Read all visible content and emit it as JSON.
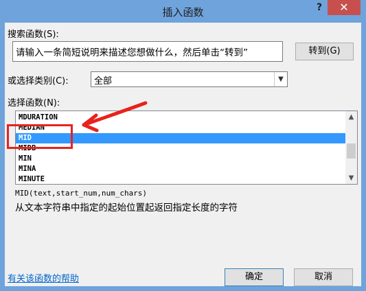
{
  "window": {
    "title": "插入函数",
    "help_label": "?",
    "close_label": "✕"
  },
  "search": {
    "label": "搜索函数(S):",
    "value": "请输入一条简短说明来描述您想做什么，然后单击“转到”",
    "goto_label": "转到(G)"
  },
  "category": {
    "label": "或选择类别(C):",
    "value": "全部"
  },
  "function_list": {
    "label": "选择函数(N):",
    "items": [
      "MDURATION",
      "MEDIAN",
      "MID",
      "MIDB",
      "MIN",
      "MINA",
      "MINUTE"
    ],
    "selected_index": 2
  },
  "syntax": "MID(text,start_num,num_chars)",
  "description": "从文本字符串中指定的起始位置起返回指定长度的字符",
  "footer": {
    "help_link": "有关该函数的帮助",
    "ok_label": "确定",
    "cancel_label": "取消"
  },
  "colors": {
    "title_bar": "#6fa3dc",
    "close_button": "#c7504f",
    "selection": "#3399ff",
    "annotation": "#e8221c"
  },
  "icons": {
    "scroll_up": "chevron-up-icon",
    "scroll_down": "chevron-down-icon",
    "dropdown": "chevron-down-icon"
  }
}
